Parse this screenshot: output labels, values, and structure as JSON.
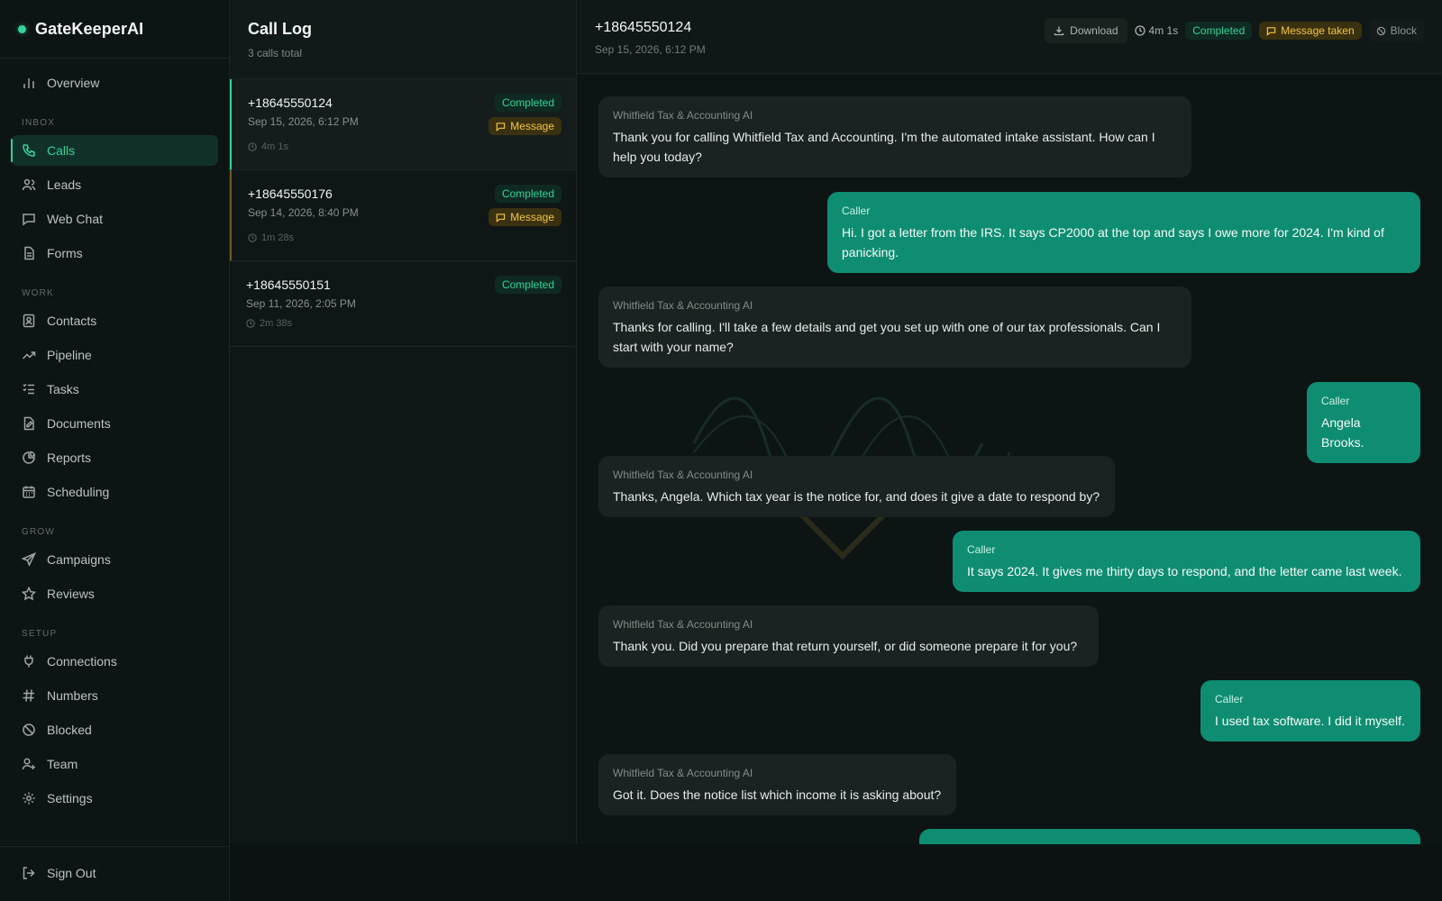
{
  "app": {
    "name": "GateKeeperAI",
    "accent": "#34d399"
  },
  "sidebar": {
    "overview": "Overview",
    "sections": {
      "inbox": "INBOX",
      "work": "WORK",
      "grow": "GROW",
      "setup": "SETUP"
    },
    "inbox_items": [
      {
        "label": "Calls",
        "icon": "phone-icon",
        "active": true
      },
      {
        "label": "Leads",
        "icon": "users-icon"
      },
      {
        "label": "Web Chat",
        "icon": "chat-icon"
      },
      {
        "label": "Forms",
        "icon": "form-icon"
      }
    ],
    "work_items": [
      {
        "label": "Contacts",
        "icon": "contacts-icon"
      },
      {
        "label": "Pipeline",
        "icon": "trend-icon"
      },
      {
        "label": "Tasks",
        "icon": "tasks-icon"
      },
      {
        "label": "Documents",
        "icon": "document-icon"
      },
      {
        "label": "Reports",
        "icon": "pie-chart-icon"
      },
      {
        "label": "Scheduling",
        "icon": "calendar-icon"
      }
    ],
    "grow_items": [
      {
        "label": "Campaigns",
        "icon": "send-icon"
      },
      {
        "label": "Reviews",
        "icon": "star-icon"
      }
    ],
    "setup_items": [
      {
        "label": "Connections",
        "icon": "plug-icon"
      },
      {
        "label": "Numbers",
        "icon": "hash-icon"
      },
      {
        "label": "Blocked",
        "icon": "ban-icon"
      },
      {
        "label": "Team",
        "icon": "user-plus-icon"
      },
      {
        "label": "Settings",
        "icon": "gear-icon"
      }
    ],
    "sign_out": "Sign Out"
  },
  "call_log": {
    "title": "Call Log",
    "subtitle": "3 calls total",
    "calls": [
      {
        "number": "+18645550124",
        "date": "Sep 15, 2026, 6:12 PM",
        "duration": "4m 1s",
        "status": "Completed",
        "tag": "Message"
      },
      {
        "number": "+18645550176",
        "date": "Sep 14, 2026, 8:40 PM",
        "duration": "1m 28s",
        "status": "Completed",
        "tag": "Message"
      },
      {
        "number": "+18645550151",
        "date": "Sep 11, 2026, 2:05 PM",
        "duration": "2m 38s",
        "status": "Completed"
      }
    ]
  },
  "detail": {
    "number": "+18645550124",
    "date": "Sep 15, 2026, 6:12 PM",
    "download": "Download",
    "duration": "4m 1s",
    "status": "Completed",
    "message_tag": "Message taken",
    "block": "Block",
    "messages": [
      {
        "from": "Whitfield Tax & Accounting AI",
        "role": "ai",
        "text": "Thank you for calling Whitfield Tax and Accounting. I'm the automated intake assistant. How can I help you today?"
      },
      {
        "from": "Caller",
        "role": "caller",
        "text": "Hi. I got a letter from the IRS. It says CP2000 at the top and says I owe more for 2024. I'm kind of panicking."
      },
      {
        "from": "Whitfield Tax & Accounting AI",
        "role": "ai",
        "text": "Thanks for calling. I'll take a few details and get you set up with one of our tax professionals. Can I start with your name?"
      },
      {
        "from": "Caller",
        "role": "caller",
        "text": "Angela Brooks."
      },
      {
        "from": "Whitfield Tax & Accounting AI",
        "role": "ai",
        "text": "Thanks, Angela. Which tax year is the notice for, and does it give a date to respond by?"
      },
      {
        "from": "Caller",
        "role": "caller",
        "text": "It says 2024. It gives me thirty days to respond, and the letter came last week."
      },
      {
        "from": "Whitfield Tax & Accounting AI",
        "role": "ai",
        "text": "Thank you. Did you prepare that return yourself, or did someone prepare it for you?"
      },
      {
        "from": "Caller",
        "role": "caller",
        "text": "I used tax software. I did it myself."
      },
      {
        "from": "Whitfield Tax & Accounting AI",
        "role": "ai",
        "text": "Got it. Does the notice list which income it is asking about?"
      }
    ]
  }
}
